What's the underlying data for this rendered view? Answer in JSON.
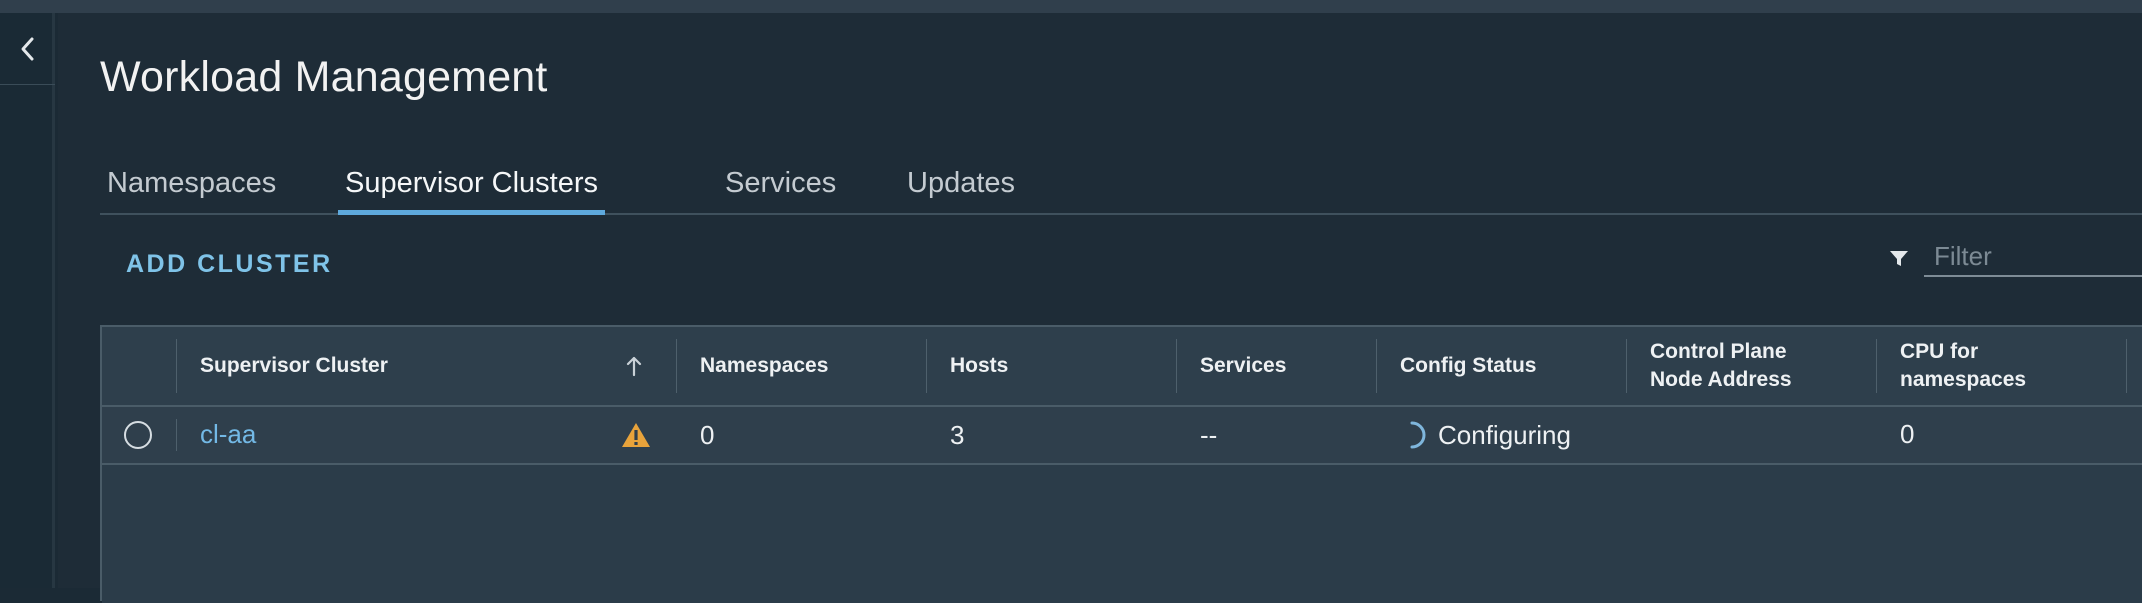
{
  "page": {
    "title": "Workload Management"
  },
  "tabs": [
    {
      "label": "Namespaces",
      "active": false
    },
    {
      "label": "Supervisor Clusters",
      "active": true
    },
    {
      "label": "Services",
      "active": false
    },
    {
      "label": "Updates",
      "active": false
    }
  ],
  "toolbar": {
    "add_cluster_label": "ADD CLUSTER",
    "filter_placeholder": "Filter"
  },
  "table": {
    "columns": [
      {
        "key": "cluster",
        "label": "Supervisor Cluster",
        "sorted": "ascending"
      },
      {
        "key": "namespaces",
        "label": "Namespaces"
      },
      {
        "key": "hosts",
        "label": "Hosts"
      },
      {
        "key": "services",
        "label": "Services"
      },
      {
        "key": "config_status",
        "label": "Config Status"
      },
      {
        "key": "control_plane",
        "label": "Control Plane Node Address"
      },
      {
        "key": "cpu",
        "label": "CPU for namespaces"
      }
    ],
    "rows": [
      {
        "cluster": "cl-aa",
        "warning": true,
        "namespaces": "0",
        "hosts": "3",
        "services": "--",
        "config_status": "Configuring",
        "control_plane": "",
        "cpu": "0"
      }
    ]
  },
  "colors": {
    "accent": "#5ea9dd",
    "link": "#73b9e6",
    "warning": "#e8a33b",
    "background": "#1e2c37"
  }
}
